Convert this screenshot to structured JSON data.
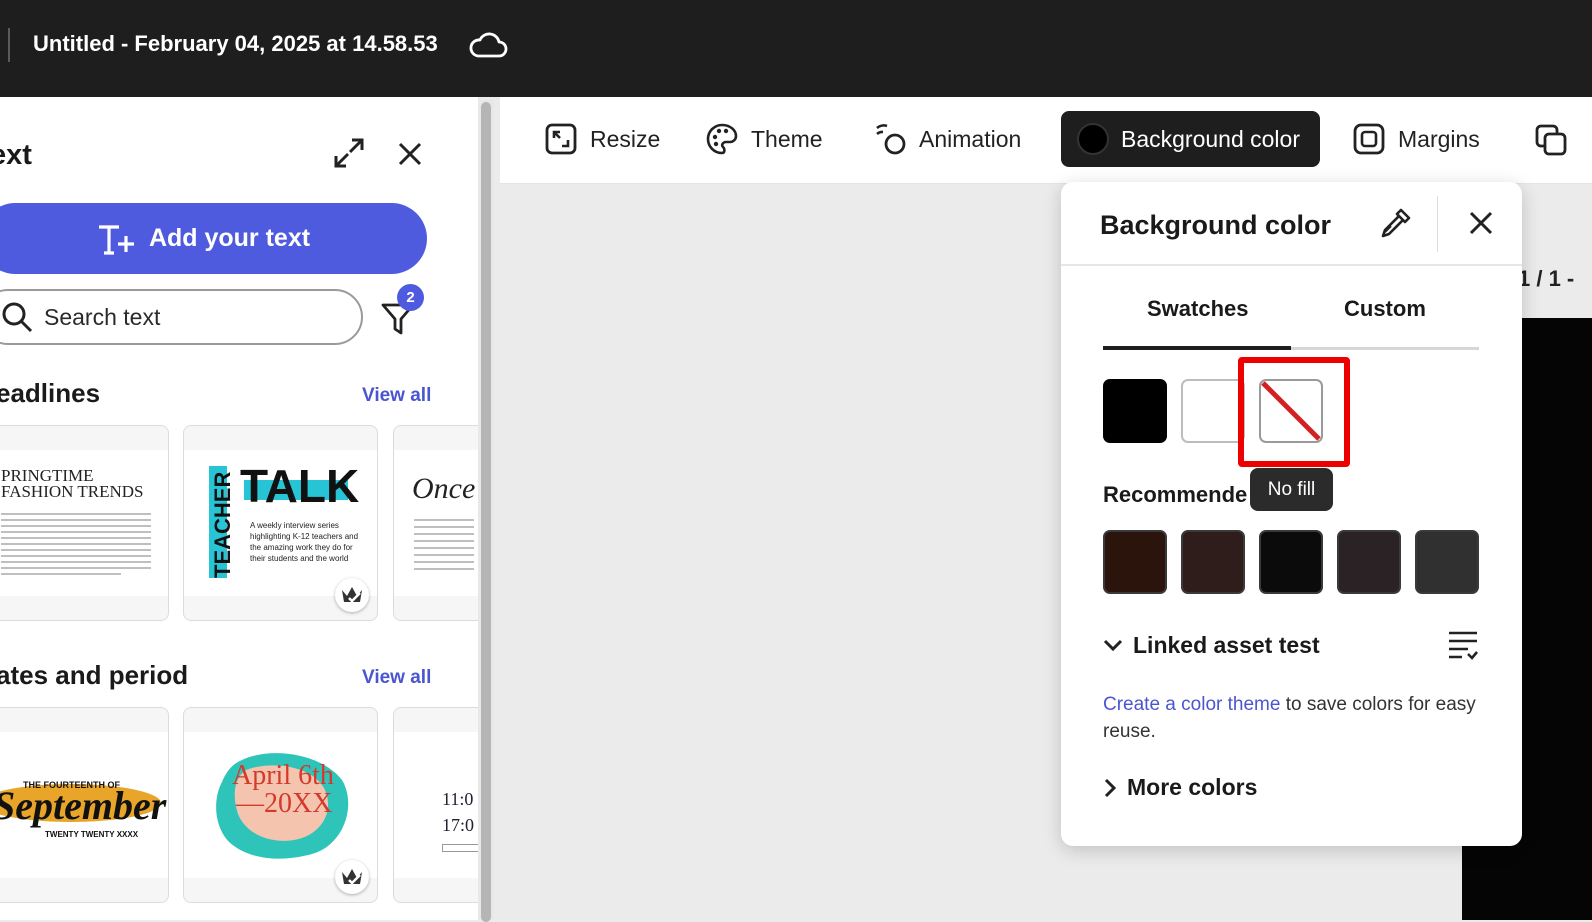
{
  "header": {
    "document_title": "Untitled - February 04, 2025 at 14.58.53",
    "cloud_icon": "cloud-icon"
  },
  "left_panel": {
    "title": "ext",
    "add_text_label": "Add your text",
    "search": {
      "placeholder": "Search text",
      "value": ""
    },
    "filter_badge": "2",
    "sections": [
      {
        "title": "eadlines",
        "view_all": "View all"
      },
      {
        "title": "ates and period",
        "view_all": "View all"
      }
    ],
    "cards": {
      "springtime": {
        "line1": "PRINGTIME",
        "line2": "FASHION TRENDS"
      },
      "teacher_talk": {
        "vertical": "TEACHER",
        "big": "TALK",
        "body": "A weekly interview series highlighting K-12 teachers and the amazing work they do for their students and the world"
      },
      "once": {
        "script": "Once u"
      },
      "september": {
        "top": "THE FOURTEENTH OF",
        "script": "September",
        "bottom": "TWENTY TWENTY XXXX"
      },
      "april": {
        "line1": "April 6th",
        "line2": "—20XX"
      },
      "times": {
        "line1": "11:0",
        "line2": "17:0"
      }
    }
  },
  "toolbar": {
    "items": [
      {
        "label": "Resize",
        "icon": "resize-icon"
      },
      {
        "label": "Theme",
        "icon": "palette-icon"
      },
      {
        "label": "Animation",
        "icon": "animation-icon"
      },
      {
        "label": "Background color",
        "icon": "color-swatch-icon",
        "active": true
      },
      {
        "label": "Margins",
        "icon": "margins-icon"
      }
    ]
  },
  "canvas": {
    "page_indicator": "1 / 1 -"
  },
  "background_color_popover": {
    "title": "Background color",
    "tabs": [
      {
        "label": "Swatches",
        "active": true
      },
      {
        "label": "Custom",
        "active": false
      }
    ],
    "swatches": [
      {
        "name": "black",
        "color": "#000000"
      },
      {
        "name": "white",
        "color": "#ffffff"
      },
      {
        "name": "no-fill",
        "color": "none"
      }
    ],
    "tooltip": "No fill",
    "recommended_label": "Recommende",
    "recommended": [
      "#2b140c",
      "#2e1d1b",
      "#0b0b0b",
      "#2a2224",
      "#303031"
    ],
    "linked_asset_label": "Linked asset test",
    "helper_link": "Create a color theme",
    "helper_rest": " to save colors for easy reuse.",
    "more_colors_label": "More colors"
  },
  "colors": {
    "accent": "#4f5bdf",
    "topbar": "#1e1e1e",
    "highlight": "#ec0000"
  }
}
